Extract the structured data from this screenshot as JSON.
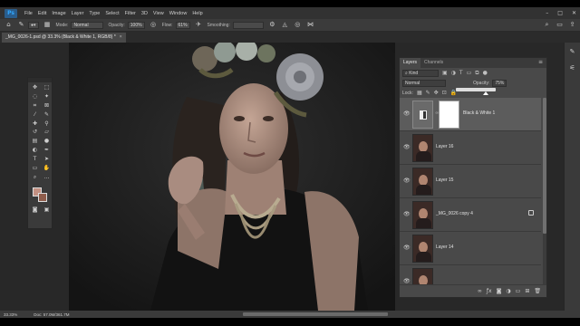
{
  "menubar": {
    "logo": "Ps",
    "items": [
      "File",
      "Edit",
      "Image",
      "Layer",
      "Type",
      "Select",
      "Filter",
      "3D",
      "View",
      "Window",
      "Help"
    ]
  },
  "options": {
    "mode_label": "Mode:",
    "mode_value": "Normal",
    "opacity_label": "Opacity:",
    "opacity_value": "100%",
    "flow_label": "Flow:",
    "flow_value": "61%",
    "smoothing_label": "Smoothing:"
  },
  "document": {
    "tab_title": "_MG_0026-1.psd @ 33.3% (Black & White 1, RGB/8) *",
    "close": "×"
  },
  "layers_panel": {
    "tabs": [
      "Layers",
      "Channels"
    ],
    "filter_value": "Kind",
    "blend_mode": "Normal",
    "opacity_label": "Opacity:",
    "opacity_value": "75%",
    "lock_label": "Lock:",
    "layers": [
      {
        "name": "Black & White 1",
        "selected": true,
        "type": "adjustment"
      },
      {
        "name": "Layer 16",
        "selected": false,
        "type": "pixel"
      },
      {
        "name": "Layer 15",
        "selected": false,
        "type": "pixel"
      },
      {
        "name": "_MG_0026 copy 4",
        "selected": false,
        "type": "smart"
      },
      {
        "name": "Layer 14",
        "selected": false,
        "type": "pixel"
      },
      {
        "name": "",
        "selected": false,
        "type": "pixel"
      }
    ]
  },
  "status": {
    "zoom": "33.33%",
    "doc_size": "Doc: 57.0M/361.7M"
  },
  "colors": {
    "foreground": "#c39082",
    "background": "#8f5d4c"
  }
}
